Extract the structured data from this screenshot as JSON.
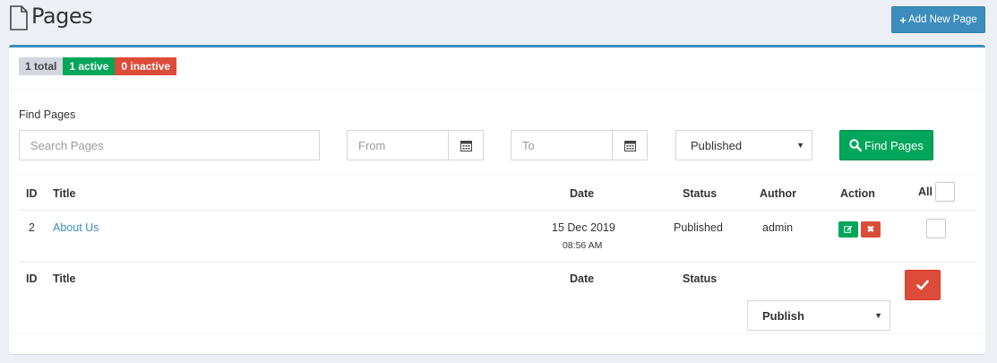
{
  "header": {
    "title": "Pages",
    "add_button_label": "Add New Page",
    "add_icon": "plus-icon"
  },
  "counts": {
    "total": "1 total",
    "active": "1 active",
    "inactive": "0 inactive"
  },
  "filter": {
    "label": "Find Pages",
    "search_placeholder": "Search Pages",
    "from_placeholder": "From",
    "to_placeholder": "To",
    "status_selected": "Published",
    "find_button_label": "Find Pages"
  },
  "table": {
    "headers": {
      "id": "ID",
      "title": "Title",
      "date": "Date",
      "status": "Status",
      "author": "Author",
      "action": "Action",
      "all": "All"
    },
    "rows": [
      {
        "id": "2",
        "title": "About Us",
        "date": "15 Dec 2019",
        "time": "08:56 AM",
        "status": "Published",
        "author": "admin"
      }
    ]
  },
  "footer": {
    "id": "ID",
    "title": "Title",
    "date": "Date",
    "status": "Status",
    "bulk_action_selected": "Publish"
  },
  "colors": {
    "primary": "#3c8dbc",
    "success": "#00a65a",
    "danger": "#dd4b39",
    "muted": "#d2d6de"
  }
}
